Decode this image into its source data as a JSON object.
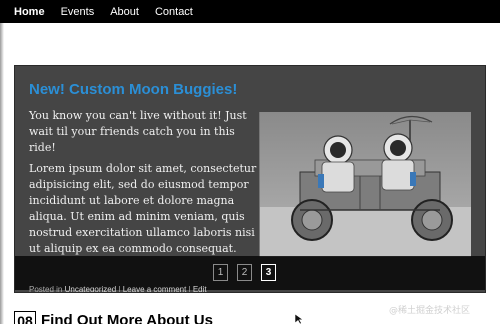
{
  "nav": {
    "items": [
      {
        "label": "Home",
        "active": true
      },
      {
        "label": "Events",
        "active": false
      },
      {
        "label": "About",
        "active": false
      },
      {
        "label": "Contact",
        "active": false
      }
    ]
  },
  "slider": {
    "title": "New! Custom Moon Buggies!",
    "lead": "You know you can't live without it! Just wait til your friends catch you in this ride!",
    "body": "Lorem ipsum dolor sit amet, consectetur adipisicing elit, sed do eiusmod tempor incididunt ut labore et dolore magna aliqua. Ut enim ad minim veniam, quis nostrud exercitation ullamco laboris nisi ut aliquip ex ea commodo consequat.",
    "image": "moon-buggy-astronauts-photo",
    "pages": [
      "1",
      "2",
      "3"
    ],
    "active_page": "3",
    "meta": {
      "posted_in": "Posted in",
      "category": "Uncategorized",
      "sep1": " | ",
      "comment": "Leave a comment",
      "sep2": " | ",
      "edit": "Edit"
    }
  },
  "section": {
    "number": "08",
    "title": "Find Out More About Us"
  },
  "watermark": "@稀土掘金技术社区",
  "colors": {
    "title_accent": "#2b8fd6",
    "nav_bg": "#000000",
    "slider_bg": "#454545"
  }
}
